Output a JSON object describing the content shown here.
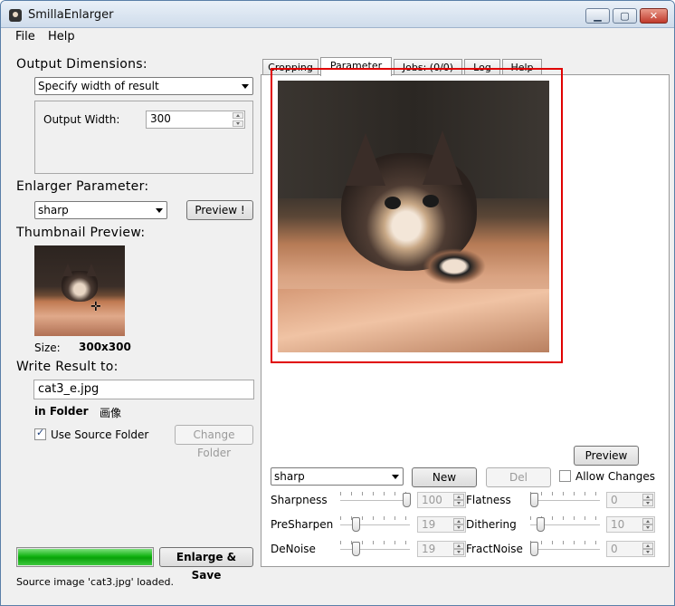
{
  "window": {
    "title": "SmillaEnlarger"
  },
  "menu": [
    "File",
    "Help"
  ],
  "output_dimensions": {
    "title": "Output Dimensions:",
    "mode": "Specify width of result",
    "width_label": "Output Width:",
    "width_value": "300"
  },
  "enlarger_parameter": {
    "title": "Enlarger Parameter:",
    "preset": "sharp",
    "preview_button": "Preview !"
  },
  "thumbnail": {
    "title": "Thumbnail Preview:",
    "size_label": "Size:",
    "size_value": "300x300"
  },
  "write_result": {
    "title": "Write Result to:",
    "filename": "cat3_e.jpg",
    "folder_label": "in Folder",
    "folder_value": "画像",
    "use_source_folder": "Use Source Folder",
    "use_source_checked": true,
    "change_folder_button": "Change Folder"
  },
  "progress": {
    "value": 1.0
  },
  "enlarge_save_button": "Enlarge & Save",
  "status": "Source image 'cat3.jpg' loaded.",
  "tabs": [
    "Cropping",
    "Parameter",
    "Jobs: (0/0)",
    "Log",
    "Help"
  ],
  "active_tab": 1,
  "parameter_panel": {
    "preview_button": "Preview",
    "preset_value": "sharp",
    "new_button": "New",
    "del_button": "Del",
    "allow_changes": "Allow Changes",
    "params": [
      {
        "label": "Sharpness",
        "value": "100",
        "max": 100
      },
      {
        "label": "Flatness",
        "value": "0",
        "max": 100
      },
      {
        "label": "PreSharpen",
        "value": "19",
        "max": 100
      },
      {
        "label": "Dithering",
        "value": "10",
        "max": 100
      },
      {
        "label": "DeNoise",
        "value": "19",
        "max": 100
      },
      {
        "label": "FractNoise",
        "value": "0",
        "max": 100
      }
    ]
  },
  "colors": {
    "selection_frame": "#e00000",
    "progress": "#12b312"
  }
}
